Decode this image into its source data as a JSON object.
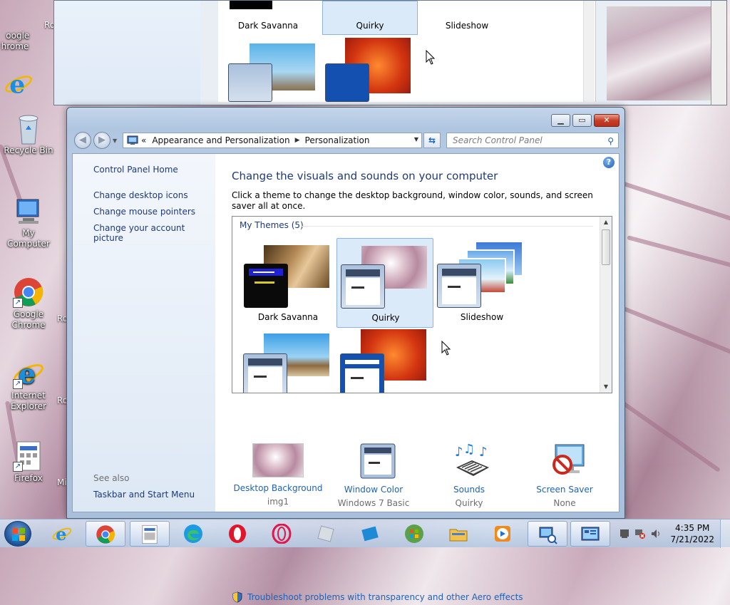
{
  "desktop": {
    "icons": [
      {
        "label": "Recycle Bin"
      },
      {
        "label": "My Computer"
      },
      {
        "label": "Google Chrome"
      },
      {
        "label": "Internet Explorer"
      },
      {
        "label": "Firefox"
      }
    ],
    "top_partial": {
      "label": "oogle\nhrome"
    },
    "partial_labels": {
      "chrome_side": "Ro",
      "ie_side": "Ro",
      "firefox_side": "Mi",
      "top_side": "Ro"
    }
  },
  "background_window": {
    "themes": [
      "Dark Savanna",
      "Quirky",
      "Slideshow"
    ]
  },
  "window": {
    "address": {
      "root": "«",
      "crumbs": [
        "Appearance and Personalization",
        "Personalization"
      ]
    },
    "search_placeholder": "Search Control Panel",
    "left_pane": {
      "home": "Control Panel Home",
      "links": [
        "Change desktop icons",
        "Change mouse pointers",
        "Change your account picture"
      ],
      "see_also": "See also",
      "see_also_links": [
        "Taskbar and Start Menu"
      ]
    },
    "heading": "Change the visuals and sounds on your computer",
    "subheading": "Click a theme to change the desktop background, window color, sounds, and screen saver all at once.",
    "themes_group": "My Themes (5)",
    "themes": [
      {
        "name": "Dark Savanna",
        "selected": false
      },
      {
        "name": "Quirky",
        "selected": true
      },
      {
        "name": "Slideshow",
        "selected": false
      }
    ],
    "settings": [
      {
        "label": "Desktop Background",
        "value": "img1",
        "icon": "wallpaper-thumbnail-icon"
      },
      {
        "label": "Window Color",
        "value": "Windows 7 Basic",
        "icon": "window-color-icon"
      },
      {
        "label": "Sounds",
        "value": "Quirky",
        "icon": "sounds-icon"
      },
      {
        "label": "Screen Saver",
        "value": "None",
        "icon": "screen-saver-icon"
      }
    ],
    "troubleshoot": "Troubleshoot problems with transparency and other Aero effects"
  },
  "taskbar": {
    "time": "4:35 PM",
    "date": "7/21/2022"
  },
  "colors": {
    "link": "#1e63b8",
    "heading": "#1e3a78"
  }
}
